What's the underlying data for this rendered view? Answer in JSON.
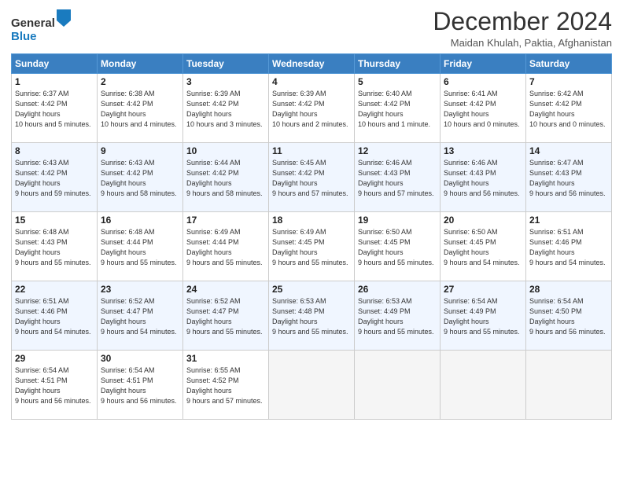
{
  "logo": {
    "line1": "General",
    "line2": "Blue"
  },
  "title": "December 2024",
  "location": "Maidan Khulah, Paktia, Afghanistan",
  "days_of_week": [
    "Sunday",
    "Monday",
    "Tuesday",
    "Wednesday",
    "Thursday",
    "Friday",
    "Saturday"
  ],
  "weeks": [
    [
      {
        "day": 1,
        "sunrise": "6:37 AM",
        "sunset": "4:42 PM",
        "daylight": "10 hours and 5 minutes."
      },
      {
        "day": 2,
        "sunrise": "6:38 AM",
        "sunset": "4:42 PM",
        "daylight": "10 hours and 4 minutes."
      },
      {
        "day": 3,
        "sunrise": "6:39 AM",
        "sunset": "4:42 PM",
        "daylight": "10 hours and 3 minutes."
      },
      {
        "day": 4,
        "sunrise": "6:39 AM",
        "sunset": "4:42 PM",
        "daylight": "10 hours and 2 minutes."
      },
      {
        "day": 5,
        "sunrise": "6:40 AM",
        "sunset": "4:42 PM",
        "daylight": "10 hours and 1 minute."
      },
      {
        "day": 6,
        "sunrise": "6:41 AM",
        "sunset": "4:42 PM",
        "daylight": "10 hours and 0 minutes."
      },
      {
        "day": 7,
        "sunrise": "6:42 AM",
        "sunset": "4:42 PM",
        "daylight": "10 hours and 0 minutes."
      }
    ],
    [
      {
        "day": 8,
        "sunrise": "6:43 AM",
        "sunset": "4:42 PM",
        "daylight": "9 hours and 59 minutes."
      },
      {
        "day": 9,
        "sunrise": "6:43 AM",
        "sunset": "4:42 PM",
        "daylight": "9 hours and 58 minutes."
      },
      {
        "day": 10,
        "sunrise": "6:44 AM",
        "sunset": "4:42 PM",
        "daylight": "9 hours and 58 minutes."
      },
      {
        "day": 11,
        "sunrise": "6:45 AM",
        "sunset": "4:42 PM",
        "daylight": "9 hours and 57 minutes."
      },
      {
        "day": 12,
        "sunrise": "6:46 AM",
        "sunset": "4:43 PM",
        "daylight": "9 hours and 57 minutes."
      },
      {
        "day": 13,
        "sunrise": "6:46 AM",
        "sunset": "4:43 PM",
        "daylight": "9 hours and 56 minutes."
      },
      {
        "day": 14,
        "sunrise": "6:47 AM",
        "sunset": "4:43 PM",
        "daylight": "9 hours and 56 minutes."
      }
    ],
    [
      {
        "day": 15,
        "sunrise": "6:48 AM",
        "sunset": "4:43 PM",
        "daylight": "9 hours and 55 minutes."
      },
      {
        "day": 16,
        "sunrise": "6:48 AM",
        "sunset": "4:44 PM",
        "daylight": "9 hours and 55 minutes."
      },
      {
        "day": 17,
        "sunrise": "6:49 AM",
        "sunset": "4:44 PM",
        "daylight": "9 hours and 55 minutes."
      },
      {
        "day": 18,
        "sunrise": "6:49 AM",
        "sunset": "4:45 PM",
        "daylight": "9 hours and 55 minutes."
      },
      {
        "day": 19,
        "sunrise": "6:50 AM",
        "sunset": "4:45 PM",
        "daylight": "9 hours and 55 minutes."
      },
      {
        "day": 20,
        "sunrise": "6:50 AM",
        "sunset": "4:45 PM",
        "daylight": "9 hours and 54 minutes."
      },
      {
        "day": 21,
        "sunrise": "6:51 AM",
        "sunset": "4:46 PM",
        "daylight": "9 hours and 54 minutes."
      }
    ],
    [
      {
        "day": 22,
        "sunrise": "6:51 AM",
        "sunset": "4:46 PM",
        "daylight": "9 hours and 54 minutes."
      },
      {
        "day": 23,
        "sunrise": "6:52 AM",
        "sunset": "4:47 PM",
        "daylight": "9 hours and 54 minutes."
      },
      {
        "day": 24,
        "sunrise": "6:52 AM",
        "sunset": "4:47 PM",
        "daylight": "9 hours and 55 minutes."
      },
      {
        "day": 25,
        "sunrise": "6:53 AM",
        "sunset": "4:48 PM",
        "daylight": "9 hours and 55 minutes."
      },
      {
        "day": 26,
        "sunrise": "6:53 AM",
        "sunset": "4:49 PM",
        "daylight": "9 hours and 55 minutes."
      },
      {
        "day": 27,
        "sunrise": "6:54 AM",
        "sunset": "4:49 PM",
        "daylight": "9 hours and 55 minutes."
      },
      {
        "day": 28,
        "sunrise": "6:54 AM",
        "sunset": "4:50 PM",
        "daylight": "9 hours and 56 minutes."
      }
    ],
    [
      {
        "day": 29,
        "sunrise": "6:54 AM",
        "sunset": "4:51 PM",
        "daylight": "9 hours and 56 minutes."
      },
      {
        "day": 30,
        "sunrise": "6:54 AM",
        "sunset": "4:51 PM",
        "daylight": "9 hours and 56 minutes."
      },
      {
        "day": 31,
        "sunrise": "6:55 AM",
        "sunset": "4:52 PM",
        "daylight": "9 hours and 57 minutes."
      },
      null,
      null,
      null,
      null
    ]
  ],
  "labels": {
    "sunrise": "Sunrise:",
    "sunset": "Sunset:",
    "daylight": "Daylight hours"
  }
}
